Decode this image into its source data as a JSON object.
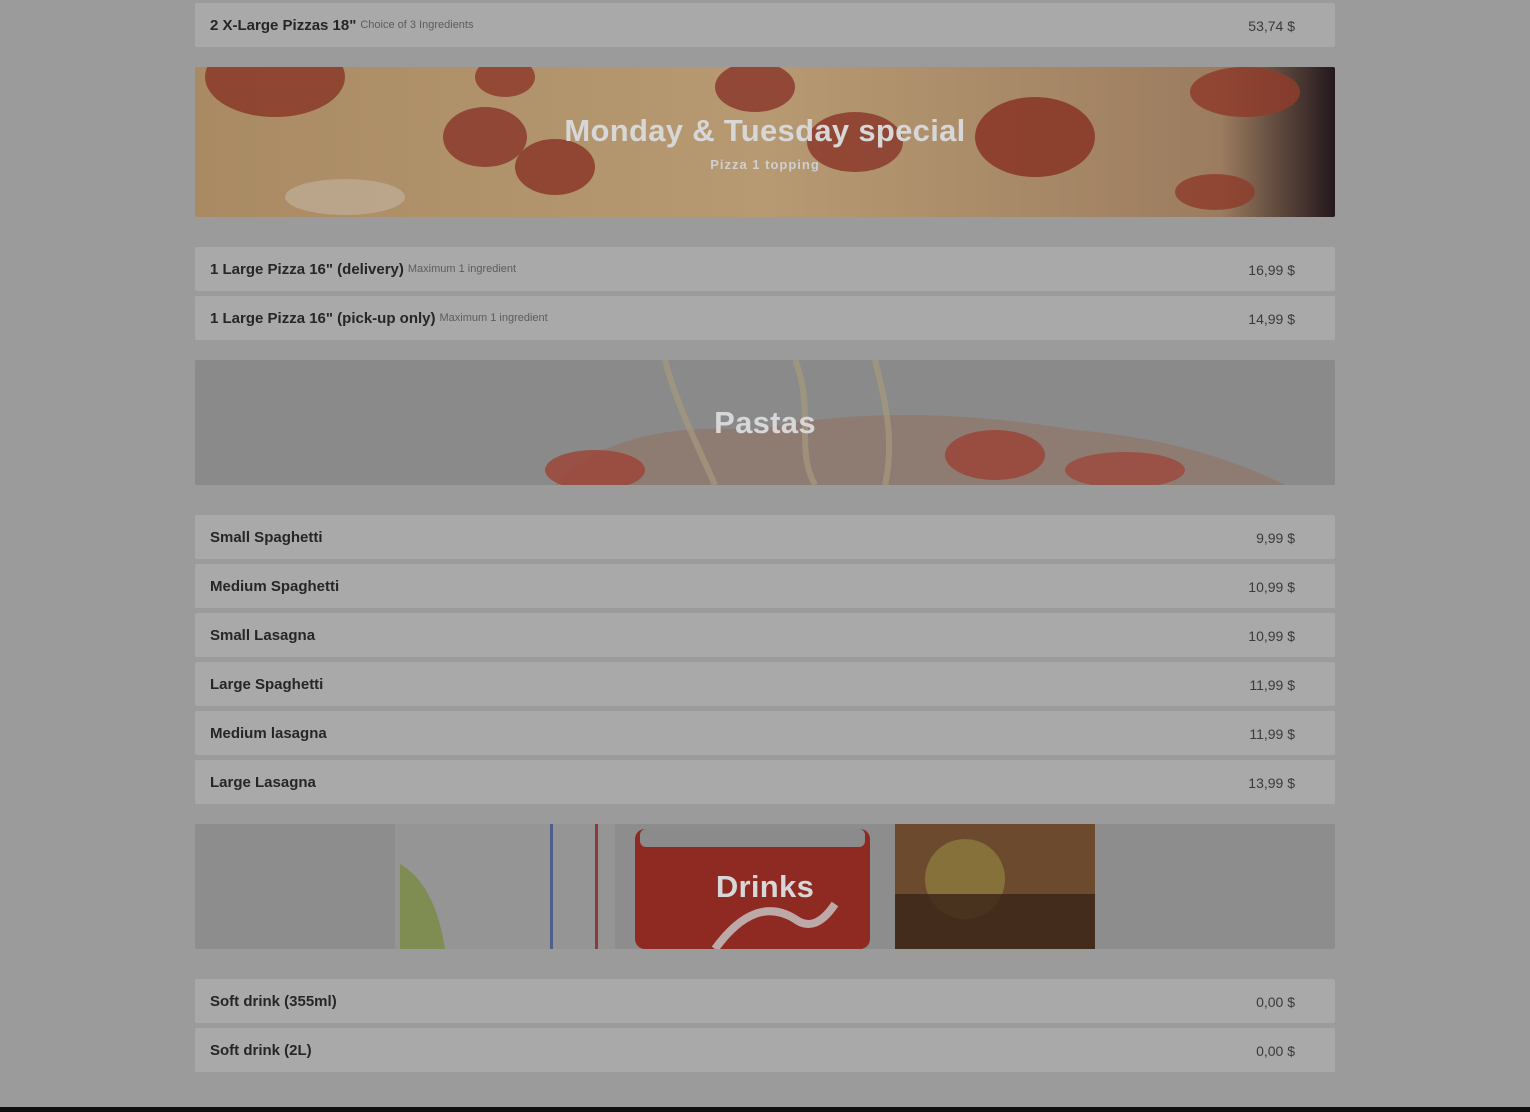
{
  "top_item": {
    "name": "2 X-Large Pizzas 18\"",
    "desc": "Choice of 3 Ingredients",
    "price": "53,74 $"
  },
  "special": {
    "title": "Monday & Tuesday special",
    "subtitle": "Pizza 1 topping",
    "items": [
      {
        "name": "1 Large Pizza 16\" (delivery)",
        "desc": "Maximum 1 ingredient",
        "price": "16,99 $"
      },
      {
        "name": "1 Large Pizza 16\" (pick-up only)",
        "desc": "Maximum 1 ingredient",
        "price": "14,99 $"
      }
    ]
  },
  "pastas": {
    "title": "Pastas",
    "items": [
      {
        "name": "Small Spaghetti",
        "price": "9,99 $"
      },
      {
        "name": "Medium Spaghetti",
        "price": "10,99 $"
      },
      {
        "name": "Small Lasagna",
        "price": "10,99 $"
      },
      {
        "name": "Large Spaghetti",
        "price": "11,99 $"
      },
      {
        "name": "Medium lasagna",
        "price": "11,99 $"
      },
      {
        "name": "Large Lasagna",
        "price": "13,99 $"
      }
    ]
  },
  "drinks": {
    "title": "Drinks",
    "items": [
      {
        "name": "Soft drink (355ml)",
        "price": "0,00 $"
      },
      {
        "name": "Soft drink (2L)",
        "price": "0,00 $"
      }
    ]
  },
  "colors": {
    "overlay": "#9b9b9b",
    "row": "#a9a9a9",
    "footer": "#0f0f0f"
  }
}
